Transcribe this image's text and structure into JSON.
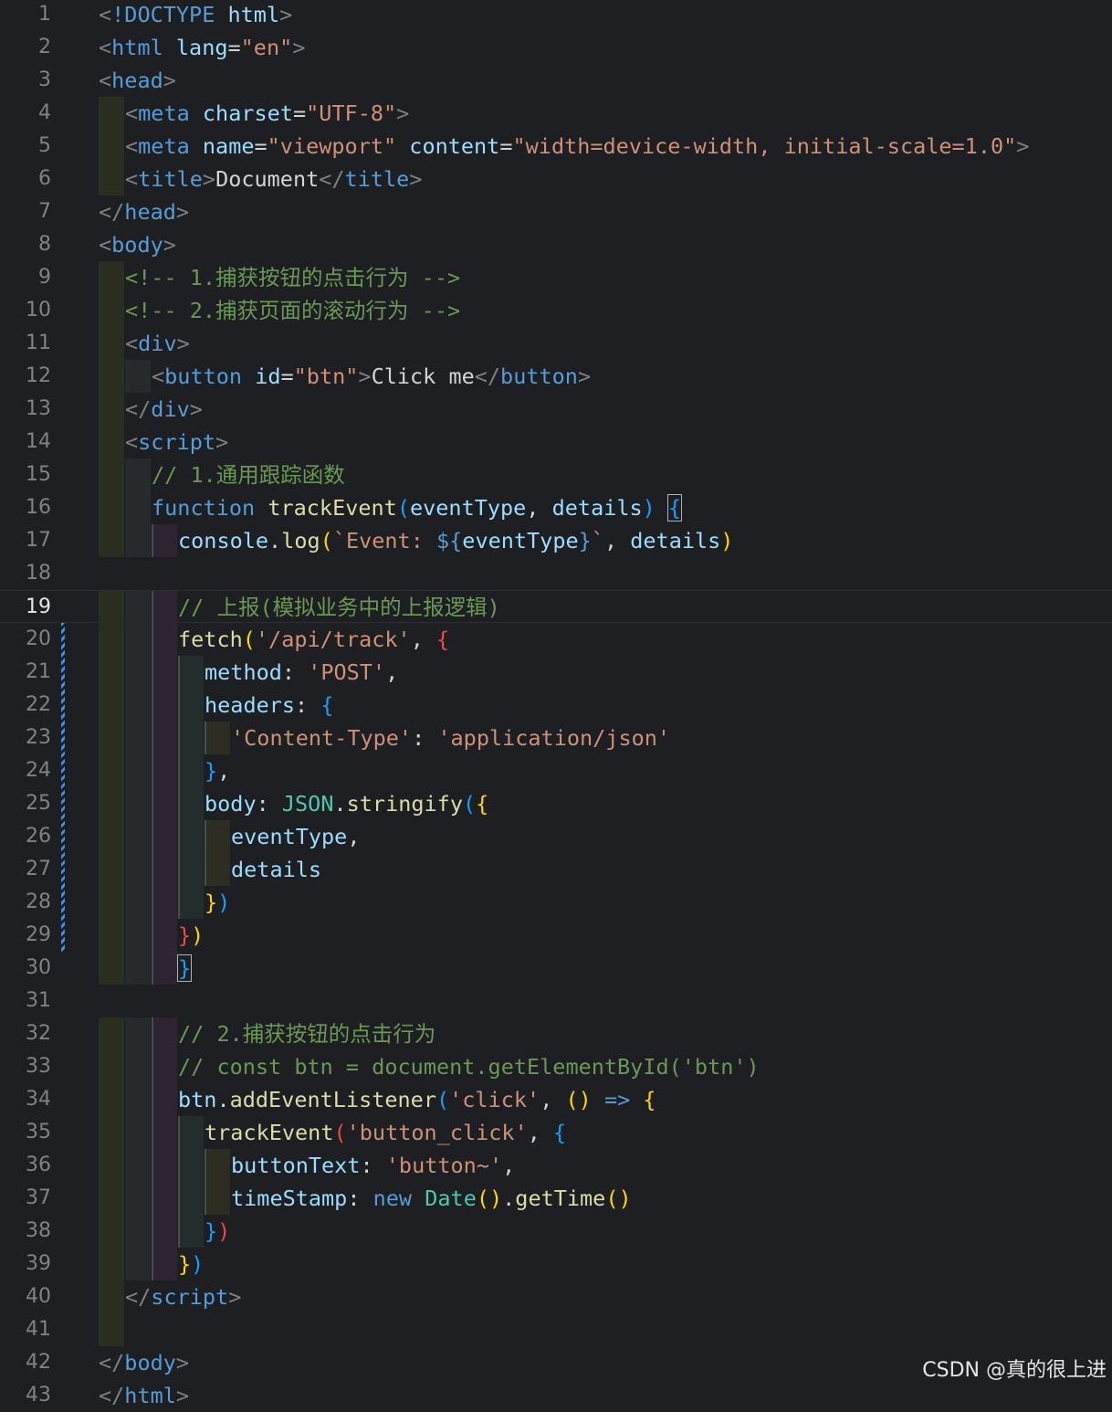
{
  "editor": {
    "current_line": 19,
    "lines": [
      {
        "n": "1",
        "depth": 0,
        "tokens": [
          [
            "p",
            "<"
          ],
          [
            "k",
            "!DOCTYPE"
          ],
          [
            "x",
            " "
          ],
          [
            "a",
            "html"
          ],
          [
            "p",
            ">"
          ]
        ]
      },
      {
        "n": "2",
        "depth": 0,
        "tokens": [
          [
            "p",
            "<"
          ],
          [
            "t",
            "html"
          ],
          [
            "x",
            " "
          ],
          [
            "a",
            "lang"
          ],
          [
            "x",
            "="
          ],
          [
            "s",
            "\"en\""
          ],
          [
            "p",
            ">"
          ]
        ]
      },
      {
        "n": "3",
        "depth": 0,
        "tokens": [
          [
            "p",
            "<"
          ],
          [
            "t",
            "head"
          ],
          [
            "p",
            ">"
          ]
        ]
      },
      {
        "n": "4",
        "depth": 1,
        "tokens": [
          [
            "p",
            "<"
          ],
          [
            "t",
            "meta"
          ],
          [
            "x",
            " "
          ],
          [
            "a",
            "charset"
          ],
          [
            "x",
            "="
          ],
          [
            "s",
            "\"UTF-8\""
          ],
          [
            "p",
            ">"
          ]
        ]
      },
      {
        "n": "5",
        "depth": 1,
        "tokens": [
          [
            "p",
            "<"
          ],
          [
            "t",
            "meta"
          ],
          [
            "x",
            " "
          ],
          [
            "a",
            "name"
          ],
          [
            "x",
            "="
          ],
          [
            "s",
            "\"viewport\""
          ],
          [
            "x",
            " "
          ],
          [
            "a",
            "content"
          ],
          [
            "x",
            "="
          ],
          [
            "s",
            "\"width=device-width, initial-scale=1.0\""
          ],
          [
            "p",
            ">"
          ]
        ]
      },
      {
        "n": "6",
        "depth": 1,
        "tokens": [
          [
            "p",
            "<"
          ],
          [
            "t",
            "title"
          ],
          [
            "p",
            ">"
          ],
          [
            "x",
            "Document"
          ],
          [
            "p",
            "</"
          ],
          [
            "t",
            "title"
          ],
          [
            "p",
            ">"
          ]
        ]
      },
      {
        "n": "7",
        "depth": 0,
        "tokens": [
          [
            "p",
            "</"
          ],
          [
            "t",
            "head"
          ],
          [
            "p",
            ">"
          ]
        ]
      },
      {
        "n": "8",
        "depth": 0,
        "tokens": [
          [
            "p",
            "<"
          ],
          [
            "t",
            "body"
          ],
          [
            "p",
            ">"
          ]
        ]
      },
      {
        "n": "9",
        "depth": 1,
        "tokens": [
          [
            "c",
            "<!-- 1.捕获按钮的点击行为 -->"
          ]
        ]
      },
      {
        "n": "10",
        "depth": 1,
        "tokens": [
          [
            "c",
            "<!-- 2.捕获页面的滚动行为 -->"
          ]
        ]
      },
      {
        "n": "11",
        "depth": 1,
        "tokens": [
          [
            "p",
            "<"
          ],
          [
            "t",
            "div"
          ],
          [
            "p",
            ">"
          ]
        ]
      },
      {
        "n": "12",
        "depth": 2,
        "tokens": [
          [
            "p",
            "<"
          ],
          [
            "t",
            "button"
          ],
          [
            "x",
            " "
          ],
          [
            "a",
            "id"
          ],
          [
            "x",
            "="
          ],
          [
            "s",
            "\"btn\""
          ],
          [
            "p",
            ">"
          ],
          [
            "x",
            "Click me"
          ],
          [
            "p",
            "</"
          ],
          [
            "t",
            "button"
          ],
          [
            "p",
            ">"
          ]
        ]
      },
      {
        "n": "13",
        "depth": 1,
        "tokens": [
          [
            "p",
            "</"
          ],
          [
            "t",
            "div"
          ],
          [
            "p",
            ">"
          ]
        ]
      },
      {
        "n": "14",
        "depth": 1,
        "tokens": [
          [
            "p",
            "<"
          ],
          [
            "t",
            "script"
          ],
          [
            "p",
            ">"
          ]
        ]
      },
      {
        "n": "15",
        "depth": 2,
        "tokens": [
          [
            "c",
            "// 1.通用跟踪函数"
          ]
        ]
      },
      {
        "n": "16",
        "depth": 2,
        "tokens": [
          [
            "k",
            "function"
          ],
          [
            "x",
            " "
          ],
          [
            "f",
            "trackEvent"
          ],
          [
            "q",
            "("
          ],
          [
            "v",
            "eventType"
          ],
          [
            "o",
            ", "
          ],
          [
            "v",
            "details"
          ],
          [
            "q",
            ")"
          ],
          [
            "x",
            " "
          ],
          [
            "q",
            "{"
          ]
        ]
      },
      {
        "n": "17",
        "depth": 3,
        "tokens": [
          [
            "v",
            "console"
          ],
          [
            "o",
            "."
          ],
          [
            "f",
            "log"
          ],
          [
            "y",
            "("
          ],
          [
            "s",
            "`Event: "
          ],
          [
            "k",
            "${"
          ],
          [
            "v",
            "eventType"
          ],
          [
            "k",
            "}"
          ],
          [
            "s",
            "`"
          ],
          [
            "o",
            ", "
          ],
          [
            "v",
            "details"
          ],
          [
            "y",
            ")"
          ]
        ]
      },
      {
        "n": "18",
        "depth": 0,
        "tokens": []
      },
      {
        "n": "19",
        "depth": 3,
        "tokens": [
          [
            "c",
            "// 上报(模拟业务中的上报逻辑)"
          ]
        ]
      },
      {
        "n": "20",
        "depth": 3,
        "tokens": [
          [
            "f",
            "fetch"
          ],
          [
            "y",
            "("
          ],
          [
            "s",
            "'/api/track'"
          ],
          [
            "o",
            ", "
          ],
          [
            "r",
            "{"
          ]
        ]
      },
      {
        "n": "21",
        "depth": 4,
        "tokens": [
          [
            "v",
            "method"
          ],
          [
            "o",
            ": "
          ],
          [
            "s",
            "'POST'"
          ],
          [
            "o",
            ","
          ]
        ]
      },
      {
        "n": "22",
        "depth": 4,
        "tokens": [
          [
            "v",
            "headers"
          ],
          [
            "o",
            ": "
          ],
          [
            "q",
            "{"
          ]
        ]
      },
      {
        "n": "23",
        "depth": 5,
        "tokens": [
          [
            "s",
            "'Content-Type'"
          ],
          [
            "o",
            ": "
          ],
          [
            "s",
            "'application/json'"
          ]
        ]
      },
      {
        "n": "24",
        "depth": 4,
        "tokens": [
          [
            "q",
            "}"
          ],
          [
            "o",
            ","
          ]
        ]
      },
      {
        "n": "25",
        "depth": 4,
        "tokens": [
          [
            "v",
            "body"
          ],
          [
            "o",
            ": "
          ],
          [
            "cl",
            "JSON"
          ],
          [
            "o",
            "."
          ],
          [
            "f",
            "stringify"
          ],
          [
            "q",
            "("
          ],
          [
            "y",
            "{"
          ]
        ]
      },
      {
        "n": "26",
        "depth": 5,
        "tokens": [
          [
            "v",
            "eventType"
          ],
          [
            "o",
            ","
          ]
        ]
      },
      {
        "n": "27",
        "depth": 5,
        "tokens": [
          [
            "v",
            "details"
          ]
        ]
      },
      {
        "n": "28",
        "depth": 4,
        "tokens": [
          [
            "y",
            "}"
          ],
          [
            "q",
            ")"
          ]
        ]
      },
      {
        "n": "29",
        "depth": 3,
        "tokens": [
          [
            "r",
            "}"
          ],
          [
            "y",
            ")"
          ]
        ]
      },
      {
        "n": "30",
        "depth": 3,
        "tokens": [
          [
            "q",
            "}"
          ]
        ]
      },
      {
        "n": "31",
        "depth": 0,
        "tokens": []
      },
      {
        "n": "32",
        "depth": 3,
        "tokens": [
          [
            "c",
            "// 2.捕获按钮的点击行为"
          ]
        ]
      },
      {
        "n": "33",
        "depth": 3,
        "tokens": [
          [
            "c",
            "// const btn = document.getElementById('btn')"
          ]
        ]
      },
      {
        "n": "34",
        "depth": 3,
        "tokens": [
          [
            "v",
            "btn"
          ],
          [
            "o",
            "."
          ],
          [
            "f",
            "addEventListener"
          ],
          [
            "q",
            "("
          ],
          [
            "s",
            "'click'"
          ],
          [
            "o",
            ", "
          ],
          [
            "y",
            "()"
          ],
          [
            "x",
            " "
          ],
          [
            "k",
            "=>"
          ],
          [
            "x",
            " "
          ],
          [
            "y",
            "{"
          ]
        ]
      },
      {
        "n": "35",
        "depth": 4,
        "tokens": [
          [
            "f",
            "trackEvent"
          ],
          [
            "r",
            "("
          ],
          [
            "s",
            "'button_click'"
          ],
          [
            "o",
            ", "
          ],
          [
            "q",
            "{"
          ]
        ]
      },
      {
        "n": "36",
        "depth": 5,
        "tokens": [
          [
            "v",
            "buttonText"
          ],
          [
            "o",
            ": "
          ],
          [
            "s",
            "'button~'"
          ],
          [
            "o",
            ","
          ]
        ]
      },
      {
        "n": "37",
        "depth": 5,
        "tokens": [
          [
            "v",
            "timeStamp"
          ],
          [
            "o",
            ": "
          ],
          [
            "k",
            "new"
          ],
          [
            "x",
            " "
          ],
          [
            "cl",
            "Date"
          ],
          [
            "y",
            "()"
          ],
          [
            "o",
            "."
          ],
          [
            "f",
            "getTime"
          ],
          [
            "y",
            "()"
          ]
        ]
      },
      {
        "n": "38",
        "depth": 4,
        "tokens": [
          [
            "q",
            "}"
          ],
          [
            "r",
            ")"
          ]
        ]
      },
      {
        "n": "39",
        "depth": 3,
        "tokens": [
          [
            "y",
            "}"
          ],
          [
            "q",
            ")"
          ]
        ]
      },
      {
        "n": "40",
        "depth": 1,
        "tokens": [
          [
            "p",
            "</"
          ],
          [
            "t",
            "script"
          ],
          [
            "p",
            ">"
          ]
        ]
      },
      {
        "n": "41",
        "depth": 1,
        "tokens": []
      },
      {
        "n": "42",
        "depth": 0,
        "tokens": [
          [
            "p",
            "</"
          ],
          [
            "t",
            "body"
          ],
          [
            "p",
            ">"
          ]
        ]
      },
      {
        "n": "43",
        "depth": 0,
        "tokens": [
          [
            "p",
            "</"
          ],
          [
            "t",
            "html"
          ],
          [
            "p",
            ">"
          ]
        ]
      }
    ]
  },
  "watermark": "CSDN @真的很上进"
}
